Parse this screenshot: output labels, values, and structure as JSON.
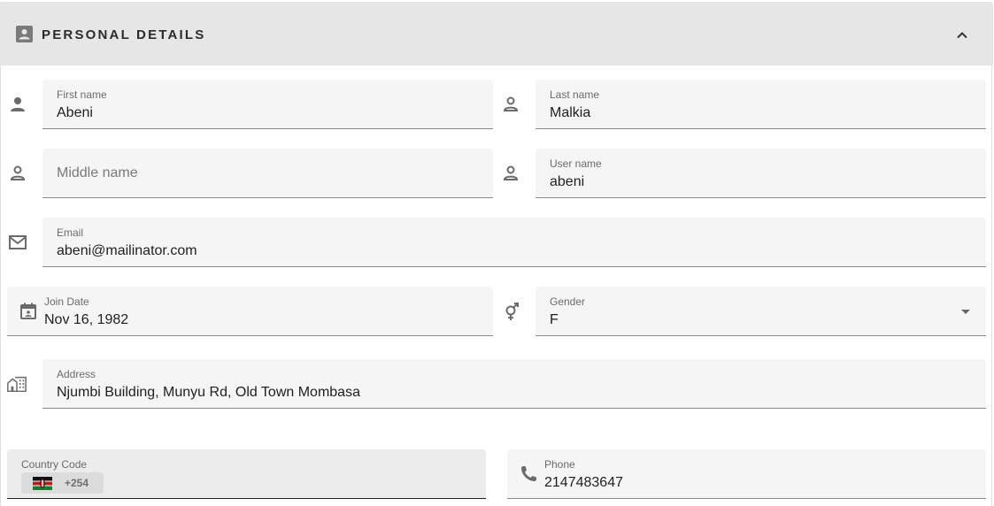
{
  "section": {
    "title": "PERSONAL DETAILS"
  },
  "fields": {
    "first_name": {
      "label": "First name",
      "value": "Abeni"
    },
    "last_name": {
      "label": "Last name",
      "value": "Malkia"
    },
    "middle_name": {
      "placeholder": "Middle name"
    },
    "user_name": {
      "label": "User name",
      "value": "abeni"
    },
    "email": {
      "label": "Email",
      "value": "abeni@mailinator.com"
    },
    "join_date": {
      "label": "Join Date",
      "value": "Nov 16, 1982"
    },
    "gender": {
      "label": "Gender",
      "value": "F"
    },
    "address": {
      "label": "Address",
      "value": "Njumbi Building, Munyu Rd, Old Town Mombasa"
    },
    "country_code": {
      "label": "Country Code",
      "value": "+254",
      "flag": "kenya-flag"
    },
    "phone": {
      "label": "Phone",
      "value": "2147483647"
    }
  },
  "icons": {
    "section": "contact-card-icon",
    "collapse": "chevron-up-icon",
    "first_name": "person-icon",
    "last_name": "person-outline-icon",
    "middle_name": "person-outline-icon",
    "user_name": "person-outline-icon",
    "email": "mail-icon",
    "join_date": "calendar-icon",
    "gender": "gender-icon",
    "address": "buildings-icon",
    "phone": "phone-icon"
  },
  "colors": {
    "header_bg": "#e6e6e6",
    "field_bg": "#f5f5f5",
    "icon": "#6b6b6b"
  }
}
